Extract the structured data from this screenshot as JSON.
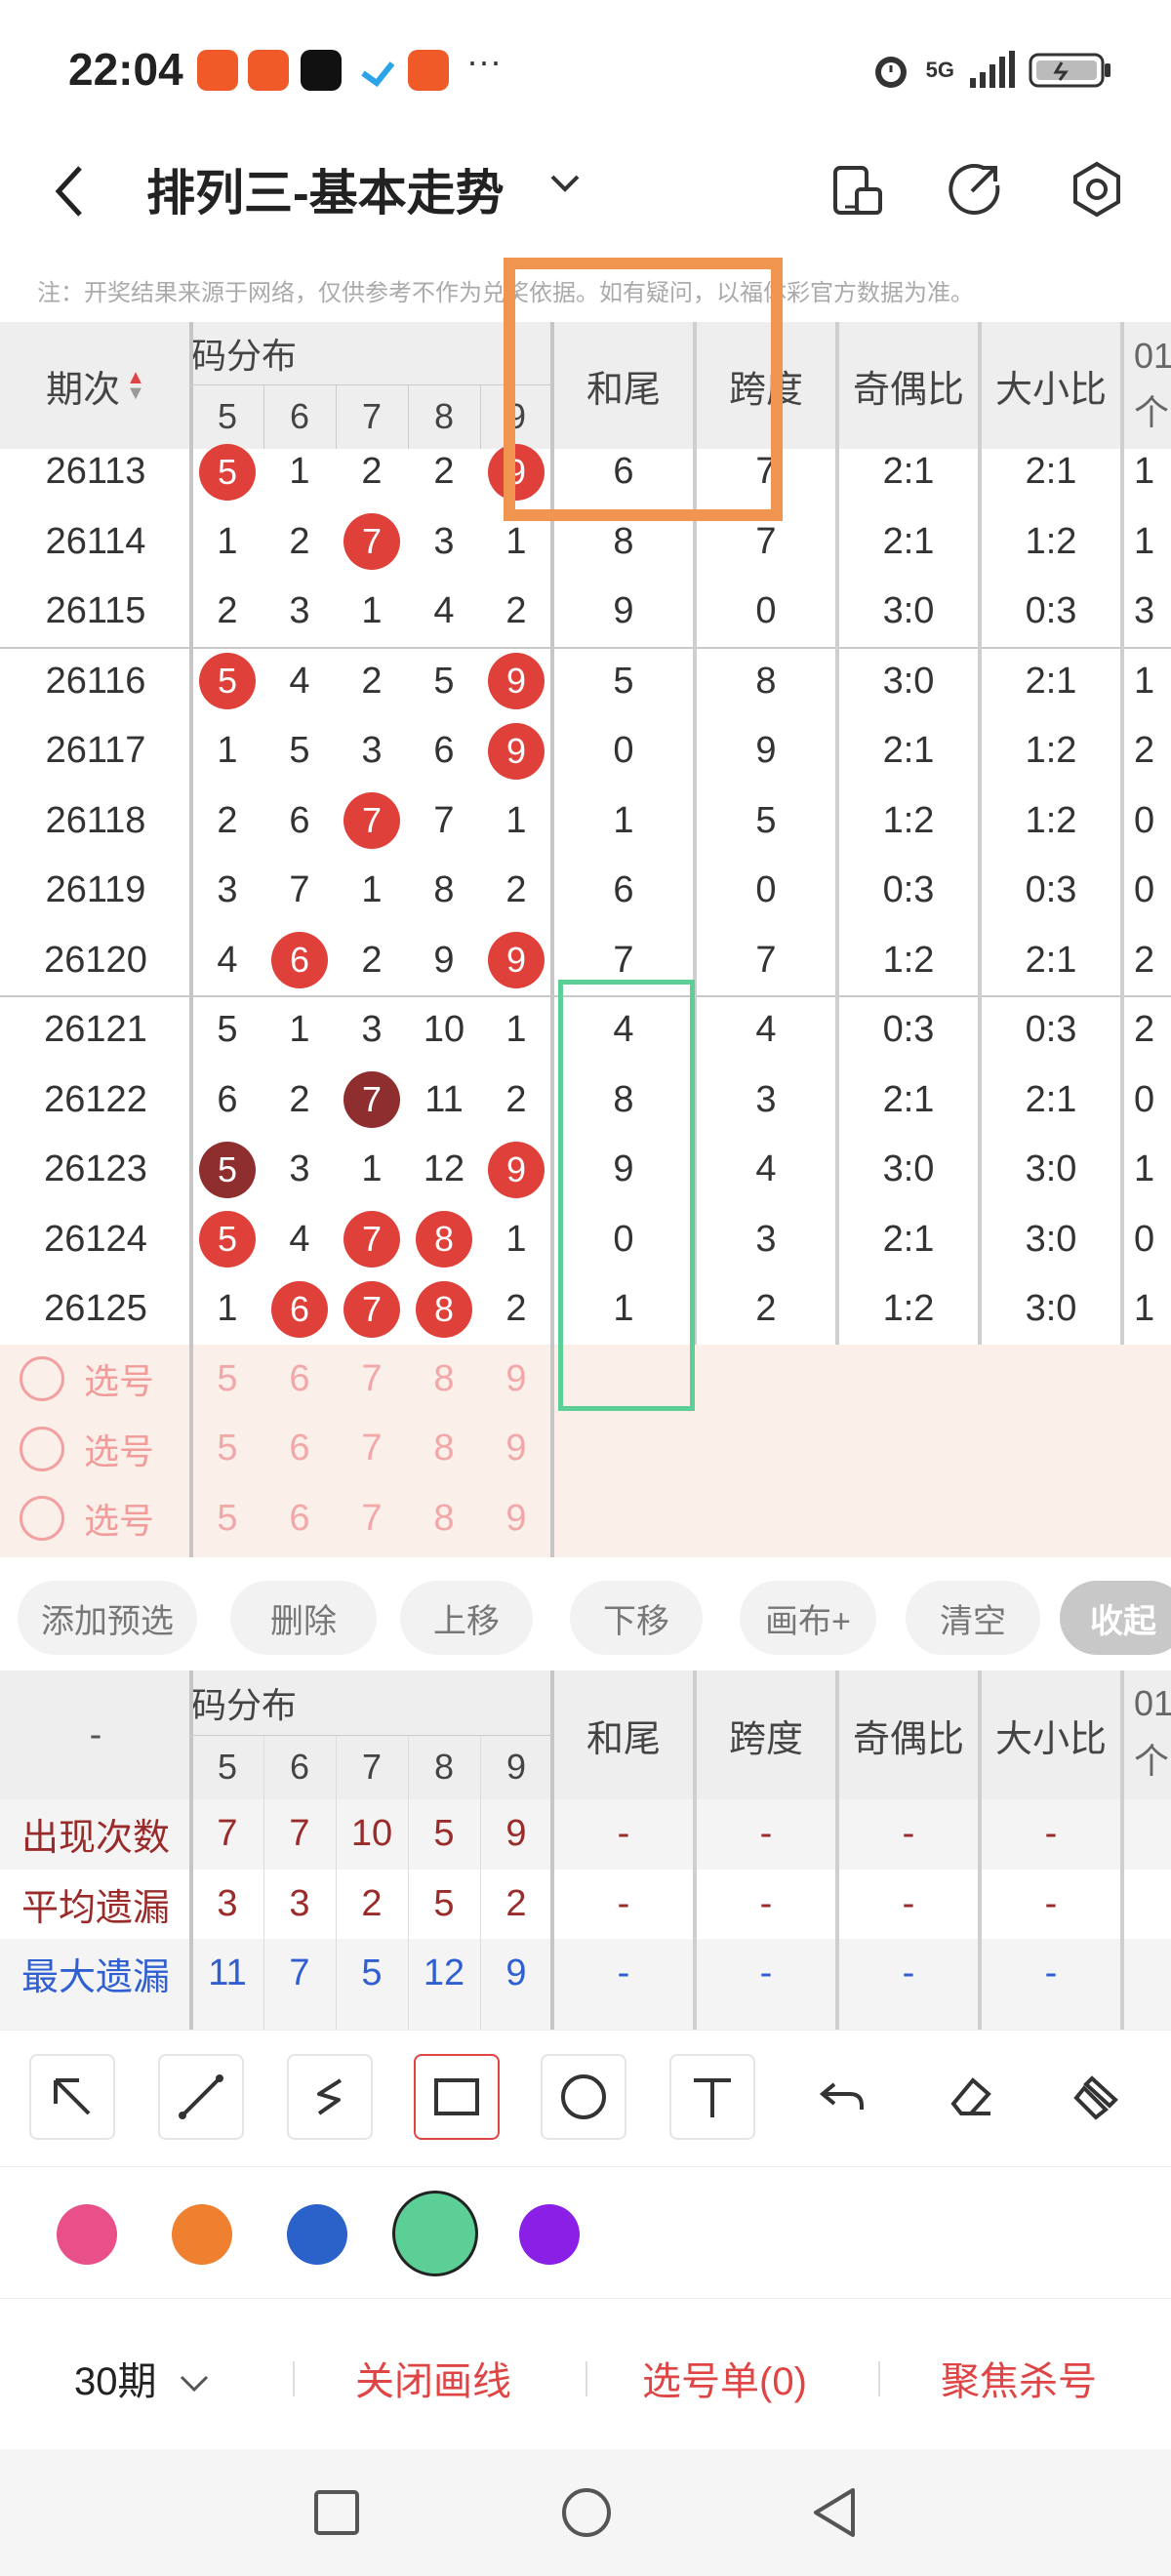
{
  "status": {
    "time": "22:04",
    "more": "···",
    "network": "5G"
  },
  "header": {
    "title": "排列三-基本走势"
  },
  "note": "注：开奖结果来源于网络，仅供参考不作为兑奖依据。如有疑问，以福体彩官方数据为准。",
  "table": {
    "col_period": "期次",
    "group_label": "码分布",
    "digit_cols": [
      "5",
      "6",
      "7",
      "8",
      "9"
    ],
    "stat_cols": [
      "和尾",
      "跨度",
      "奇偶比",
      "大小比"
    ],
    "cut_col": "01",
    "cut_col_line2": "个",
    "rows": [
      {
        "period": "26113",
        "d": [
          "5",
          "1",
          "2",
          "2",
          "9"
        ],
        "h": [
          0,
          4
        ],
        "dark": [],
        "s": [
          "6",
          "7",
          "2:1",
          "2:1"
        ],
        "c": "1"
      },
      {
        "period": "26114",
        "d": [
          "1",
          "2",
          "7",
          "3",
          "1"
        ],
        "h": [
          2
        ],
        "dark": [],
        "s": [
          "8",
          "7",
          "2:1",
          "1:2"
        ],
        "c": "1"
      },
      {
        "period": "26115",
        "d": [
          "2",
          "3",
          "1",
          "4",
          "2"
        ],
        "h": [],
        "dark": [],
        "s": [
          "9",
          "0",
          "3:0",
          "0:3"
        ],
        "c": "3"
      },
      {
        "period": "26116",
        "d": [
          "5",
          "4",
          "2",
          "5",
          "9"
        ],
        "h": [
          0,
          4
        ],
        "dark": [],
        "s": [
          "5",
          "8",
          "3:0",
          "2:1"
        ],
        "c": "1"
      },
      {
        "period": "26117",
        "d": [
          "1",
          "5",
          "3",
          "6",
          "9"
        ],
        "h": [
          4
        ],
        "dark": [],
        "s": [
          "0",
          "9",
          "2:1",
          "1:2"
        ],
        "c": "2"
      },
      {
        "period": "26118",
        "d": [
          "2",
          "6",
          "7",
          "7",
          "1"
        ],
        "h": [
          2
        ],
        "dark": [],
        "s": [
          "1",
          "5",
          "1:2",
          "1:2"
        ],
        "c": "0"
      },
      {
        "period": "26119",
        "d": [
          "3",
          "7",
          "1",
          "8",
          "2"
        ],
        "h": [],
        "dark": [],
        "s": [
          "6",
          "0",
          "0:3",
          "0:3"
        ],
        "c": "0"
      },
      {
        "period": "26120",
        "d": [
          "4",
          "6",
          "2",
          "9",
          "9"
        ],
        "h": [
          1,
          4
        ],
        "dark": [],
        "s": [
          "7",
          "7",
          "1:2",
          "2:1"
        ],
        "c": "2"
      },
      {
        "period": "26121",
        "d": [
          "5",
          "1",
          "3",
          "10",
          "1"
        ],
        "h": [],
        "dark": [],
        "s": [
          "4",
          "4",
          "0:3",
          "0:3"
        ],
        "c": "2"
      },
      {
        "period": "26122",
        "d": [
          "6",
          "2",
          "7",
          "11",
          "2"
        ],
        "h": [
          2
        ],
        "dark": [
          2
        ],
        "s": [
          "8",
          "3",
          "2:1",
          "2:1"
        ],
        "c": "0"
      },
      {
        "period": "26123",
        "d": [
          "5",
          "3",
          "1",
          "12",
          "9"
        ],
        "h": [
          0,
          4
        ],
        "dark": [
          0
        ],
        "s": [
          "9",
          "4",
          "3:0",
          "3:0"
        ],
        "c": "1"
      },
      {
        "period": "26124",
        "d": [
          "5",
          "4",
          "7",
          "8",
          "1"
        ],
        "h": [
          0,
          2,
          3
        ],
        "dark": [],
        "s": [
          "0",
          "3",
          "2:1",
          "3:0"
        ],
        "c": "0"
      },
      {
        "period": "26125",
        "d": [
          "1",
          "6",
          "7",
          "8",
          "2"
        ],
        "h": [
          1,
          2,
          3
        ],
        "dark": [],
        "s": [
          "1",
          "2",
          "1:2",
          "3:0"
        ],
        "c": "1"
      }
    ],
    "pick_label": "选号",
    "pick_digits": [
      "5",
      "6",
      "7",
      "8",
      "9"
    ]
  },
  "actions": [
    "添加预选",
    "删除",
    "上移",
    "下移",
    "画布+",
    "清空",
    "收起"
  ],
  "stats": {
    "corner": "-",
    "rows": [
      {
        "label": "出现次数",
        "vals": [
          "7",
          "7",
          "10",
          "5",
          "9"
        ],
        "color": "#9a2b2b"
      },
      {
        "label": "平均遗漏",
        "vals": [
          "3",
          "3",
          "2",
          "5",
          "2"
        ],
        "color": "#9a2b2b"
      },
      {
        "label": "最大遗漏",
        "vals": [
          "11",
          "7",
          "5",
          "12",
          "9"
        ],
        "color": "#2f5fd0"
      }
    ],
    "dash": "-"
  },
  "colors": [
    "#e9508a",
    "#ef8030",
    "#2a62c9",
    "#5ccf96",
    "#8a1fe6"
  ],
  "bottom": {
    "period_select": "30期",
    "close_draw": "关闭画线",
    "pick_list": "选号单(0)",
    "focus_kill": "聚焦杀号"
  }
}
